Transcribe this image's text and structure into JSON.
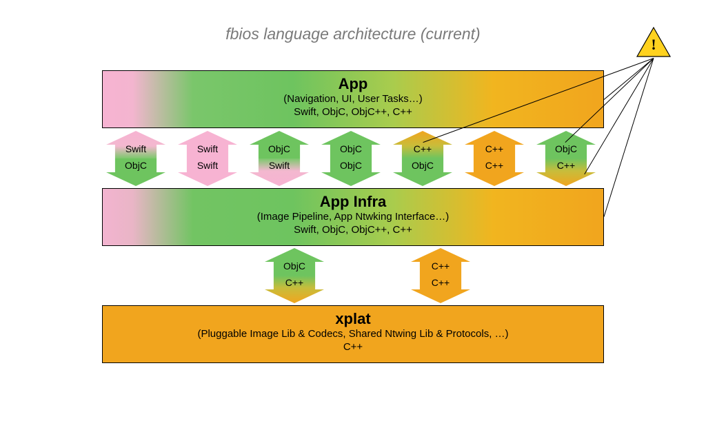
{
  "title": "fbios language architecture (current)",
  "layers": {
    "app": {
      "title": "App",
      "sub1": "(Navigation, UI, User Tasks…)",
      "sub2": "Swift, ObjC, ObjC++, C++"
    },
    "infra": {
      "title": "App Infra",
      "sub1": "(Image Pipeline, App Ntwking Interface…)",
      "sub2": "Swift, ObjC, ObjC++, C++"
    },
    "xplat": {
      "title": "xplat",
      "sub1": "(Pluggable Image Lib & Codecs, Shared Ntwing Lib & Protocols, …)",
      "sub2": "C++"
    }
  },
  "row1": [
    {
      "up": "Swift",
      "down": "ObjC"
    },
    {
      "up": "Swift",
      "down": "Swift"
    },
    {
      "up": "ObjC",
      "down": "Swift"
    },
    {
      "up": "ObjC",
      "down": "ObjC"
    },
    {
      "up": "C++",
      "down": "ObjC"
    },
    {
      "up": "C++",
      "down": "C++"
    },
    {
      "up": "ObjC",
      "down": "C++"
    }
  ],
  "row2": [
    {
      "up": "ObjC",
      "down": "C++"
    },
    {
      "up": "C++",
      "down": "C++"
    }
  ],
  "warning_glyph": "!"
}
